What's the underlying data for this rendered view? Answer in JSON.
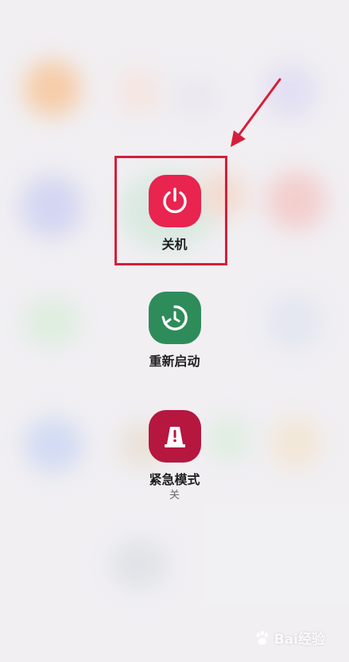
{
  "power_menu": {
    "power_off": {
      "label": "关机",
      "icon": "power-icon",
      "color": "#e8244f"
    },
    "restart": {
      "label": "重新启动",
      "icon": "restart-icon",
      "color": "#2e8c5a"
    },
    "emergency": {
      "label": "紧急模式",
      "status": "关",
      "icon": "emergency-icon",
      "color": "#b5173f"
    }
  },
  "annotation": {
    "highlight_color": "#d51f3a"
  },
  "watermark": {
    "text": "Bai经验",
    "icon": "baidu-paw-icon"
  }
}
